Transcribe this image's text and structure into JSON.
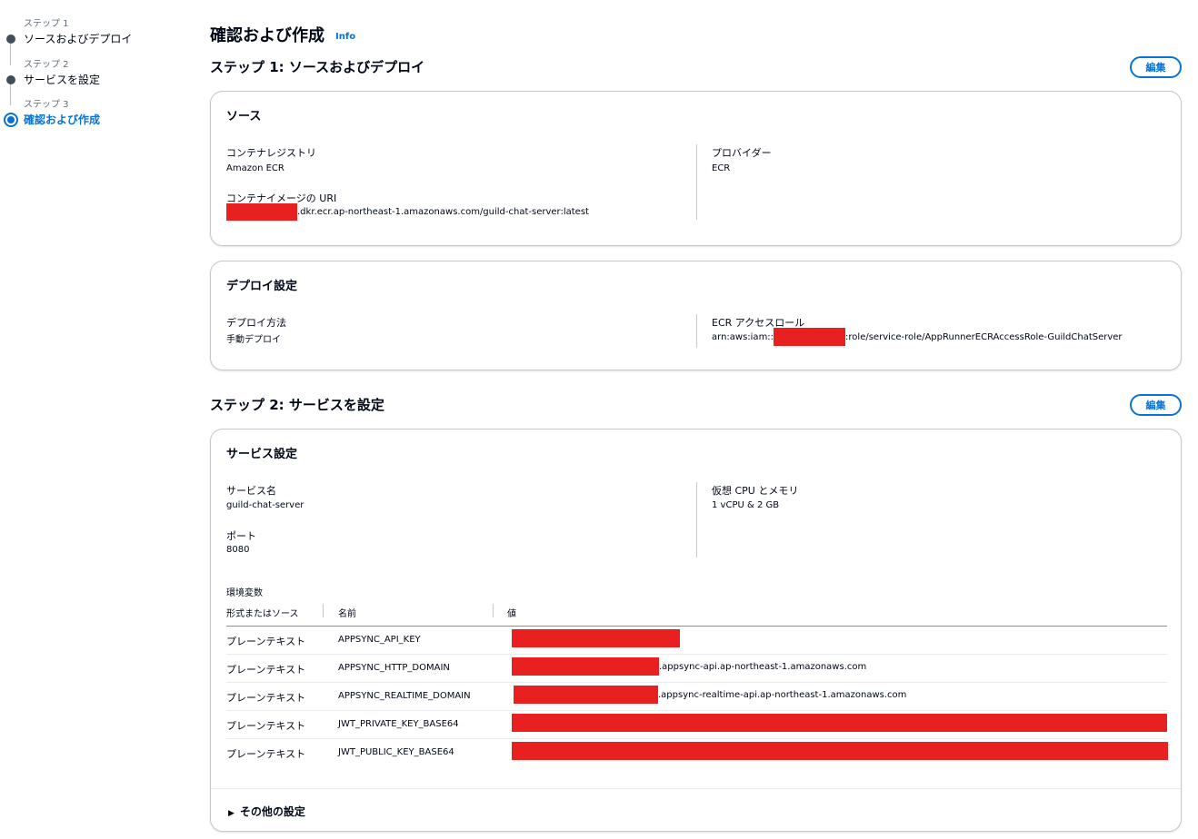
{
  "steps": [
    {
      "num": "ステップ 1",
      "title": "ソースおよびデプロイ"
    },
    {
      "num": "ステップ 2",
      "title": "サービスを設定"
    },
    {
      "num": "ステップ 3",
      "title": "確認および作成"
    }
  ],
  "page": {
    "title": "確認および作成",
    "info": "Info"
  },
  "step1": {
    "heading": "ステップ 1: ソースおよびデプロイ",
    "edit_label": "編集",
    "source": {
      "title": "ソース",
      "registry_label": "コンテナレジストリ",
      "registry_value": "Amazon ECR",
      "uri_label": "コンテナイメージの URI",
      "uri_value": ".dkr.ecr.ap-northeast-1.amazonaws.com/guild-chat-server:latest",
      "provider_label": "プロバイダー",
      "provider_value": "ECR"
    },
    "deploy": {
      "title": "デプロイ設定",
      "method_label": "デプロイ方法",
      "method_value": "手動デプロイ",
      "role_label": "ECR アクセスロール",
      "role_prefix": "arn:aws:iam::",
      "role_suffix": ":role/service-role/AppRunnerECRAccessRole-GuildChatServer"
    }
  },
  "step2": {
    "heading": "ステップ 2: サービスを設定",
    "edit_label": "編集",
    "service": {
      "title": "サービス設定",
      "name_label": "サービス名",
      "name_value": "guild-chat-server",
      "port_label": "ポート",
      "port_value": "8080",
      "cpu_label": "仮想 CPU とメモリ",
      "cpu_value": "1 vCPU & 2 GB",
      "env_title": "環境変数",
      "env_headers": [
        "形式またはソース",
        "名前",
        "値"
      ],
      "env_rows": [
        {
          "type": "プレーンテキスト",
          "name": "APPSYNC_API_KEY",
          "suffix": ""
        },
        {
          "type": "プレーンテキスト",
          "name": "APPSYNC_HTTP_DOMAIN",
          "suffix": ".appsync-api.ap-northeast-1.amazonaws.com"
        },
        {
          "type": "プレーンテキスト",
          "name": "APPSYNC_REALTIME_DOMAIN",
          "suffix": ".appsync-realtime-api.ap-northeast-1.amazonaws.com"
        },
        {
          "type": "プレーンテキスト",
          "name": "JWT_PRIVATE_KEY_BASE64",
          "suffix": ""
        },
        {
          "type": "プレーンテキスト",
          "name": "JWT_PUBLIC_KEY_BASE64",
          "suffix": ""
        }
      ],
      "more_settings": "その他の設定"
    }
  },
  "colors": {
    "accent": "#0972d3",
    "redaction": "#e82020",
    "text": "#000716"
  },
  "icons": {
    "expander": "caret-right-icon",
    "step": "step-circle-icon"
  }
}
